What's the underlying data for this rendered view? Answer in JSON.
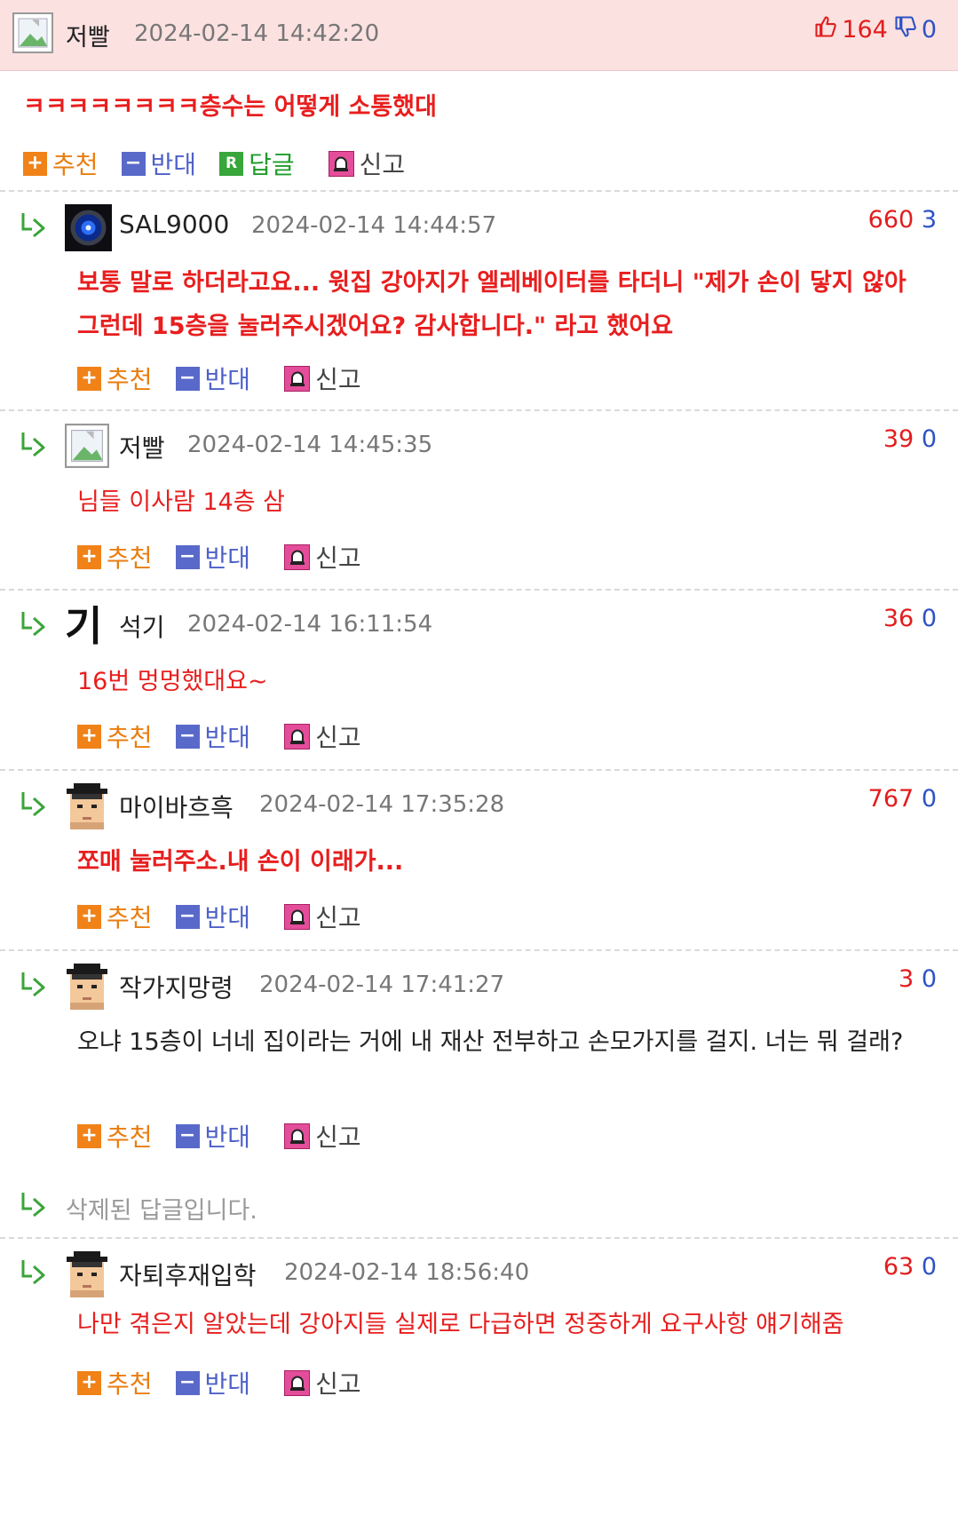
{
  "post": {
    "author": "저빨",
    "date": "2024-02-14 14:42:20",
    "up": "164",
    "down": "0",
    "text": "ㅋㅋㅋㅋㅋㅋㅋㅋ층수는 어떻게 소통했대",
    "actions": {
      "recommend": "추천",
      "oppose": "반대",
      "reply": "답글",
      "report": "신고"
    }
  },
  "labels": {
    "recommend": "추천",
    "oppose": "반대",
    "report": "신고",
    "reply_badge": "R"
  },
  "comments": [
    {
      "author": "SAL9000",
      "avatar": "hal-eye-icon",
      "date": "2024-02-14 14:44:57",
      "up": "660",
      "down": "3",
      "text": "보통 말로 하더라고요... 윗집 강아지가 엘레베이터를 타더니 \"제가 손이 닿지 않아 그런데 15층을 눌러주시겠어요? 감사합니다.\" 라고 했어요",
      "style": "red-bold"
    },
    {
      "author": "저빨",
      "avatar": "broken-image-icon",
      "date": "2024-02-14 14:45:35",
      "up": "39",
      "down": "0",
      "text": "님들 이사람 14층 삼",
      "style": "red"
    },
    {
      "author": "석기",
      "avatar": "gi-character-icon",
      "avatar_text": "기",
      "date": "2024-02-14 16:11:54",
      "up": "36",
      "down": "0",
      "text": "16번 멍멍했대요~",
      "style": "red"
    },
    {
      "author": "마이바흐흑",
      "avatar": "pixel-face-icon",
      "date": "2024-02-14 17:35:28",
      "up": "767",
      "down": "0",
      "text": "쪼매 눌러주소.내 손이 이래가...",
      "style": "red-bold"
    },
    {
      "author": "작가지망령",
      "avatar": "pixel-face-icon",
      "date": "2024-02-14 17:41:27",
      "up": "3",
      "down": "0",
      "text": "오냐 15층이 너네 집이라는 거에 내 재산 전부하고 손모가지를 걸지. 너는 뭐 걸래?",
      "style": "black"
    }
  ],
  "deleted_reply": "삭제된 답글입니다.",
  "last_comment": {
    "author": "자퇴후재입학",
    "avatar": "pixel-face-icon",
    "date": "2024-02-14 18:56:40",
    "up": "63",
    "down": "0",
    "text": "나만 겪은지 알았는데 강아지들 실제로 다급하면 정중하게 요구사항 얘기해줌",
    "style": "red"
  },
  "colors": {
    "header_bg": "#fce1e1",
    "upvote": "#e21d1d",
    "downvote": "#2d52c4",
    "recommend": "#ea7d10",
    "oppose": "#4e61c9",
    "reply": "#1f9c2a",
    "comment_red": "#e81e1e"
  }
}
